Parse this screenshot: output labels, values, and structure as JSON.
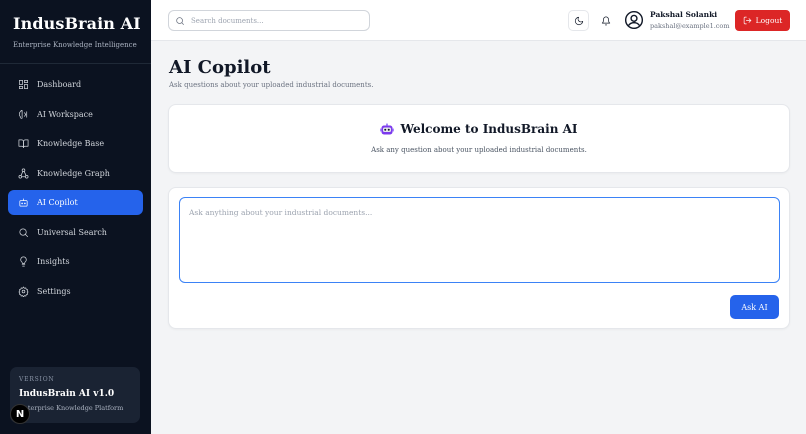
{
  "brand": {
    "title": "IndusBrain AI",
    "subtitle": "Enterprise Knowledge Intelligence"
  },
  "nav": [
    {
      "label": "Dashboard",
      "icon": "dashboard-icon"
    },
    {
      "label": "AI Workspace",
      "icon": "brain-icon"
    },
    {
      "label": "Knowledge Base",
      "icon": "book-icon"
    },
    {
      "label": "Knowledge Graph",
      "icon": "graph-icon"
    },
    {
      "label": "AI Copilot",
      "icon": "bot-icon",
      "active": true
    },
    {
      "label": "Universal Search",
      "icon": "search-icon"
    },
    {
      "label": "Insights",
      "icon": "lightbulb-icon"
    },
    {
      "label": "Settings",
      "icon": "gear-icon"
    }
  ],
  "version": {
    "label": "VERSION",
    "name": "IndusBrain AI v1.0",
    "desc": "Enterprise Knowledge Platform"
  },
  "header": {
    "search_placeholder": "Search documents...",
    "user_name": "Pakshal Solanki",
    "user_email": "pakshal@example1.com",
    "logout_label": "Logout"
  },
  "main": {
    "title": "AI Copilot",
    "subtitle": "Ask questions about your uploaded industrial documents.",
    "welcome_title": "Welcome to IndusBrain AI",
    "welcome_sub": "Ask any question about your uploaded industrial documents.",
    "chat_placeholder": "Ask anything about your industrial documents...",
    "ask_label": "Ask AI"
  },
  "colors": {
    "accent": "#2563eb",
    "sidebar_bg": "#0b1220",
    "logout": "#dc2626"
  },
  "badge": "N"
}
